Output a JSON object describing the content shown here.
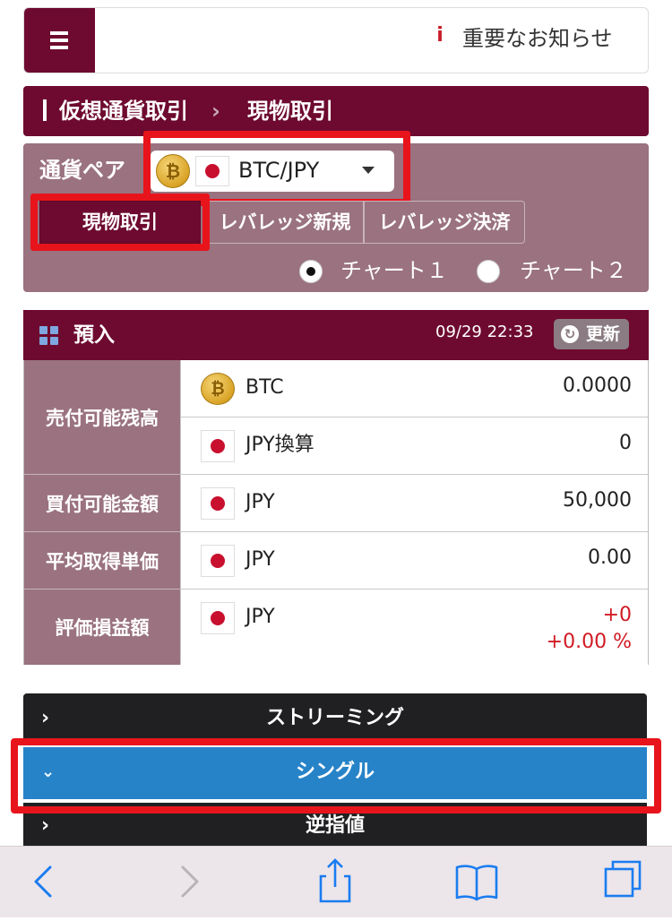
{
  "header": {
    "notice_icon": "i",
    "notice_label": "重要なお知らせ"
  },
  "breadcrumb": {
    "level1": "仮想通貨取引",
    "separator": "›",
    "level2": "現物取引"
  },
  "settings": {
    "pair_label": "通貨ペア",
    "pair_value": "BTC/JPY",
    "tabs": [
      "現物取引",
      "レバレッジ新規",
      "レバレッジ決済"
    ],
    "active_tab": "現物取引",
    "chart_options": [
      "チャート１",
      "チャート２"
    ],
    "chart_selected": "チャート１"
  },
  "account": {
    "title": "預入",
    "timestamp": "09/29 22:33",
    "refresh_label": "更新",
    "sell_available_label": "売付可能残高",
    "btc_currency": "BTC",
    "btc_value": "0.0000",
    "jpy_equiv_currency": "JPY換算",
    "jpy_equiv_value": "0",
    "buy_available_label": "買付可能金額",
    "buy_currency": "JPY",
    "buy_value": "50,000",
    "avg_price_label": "平均取得単価",
    "avg_currency": "JPY",
    "avg_value": "0.00",
    "pnl_label": "評価損益額",
    "pnl_currency": "JPY",
    "pnl_value": "+0",
    "pnl_percent": "+0.00 %"
  },
  "order_sections": {
    "streaming": "ストリーミング",
    "single": "シングル",
    "stop": "逆指値"
  },
  "colors": {
    "brand": "#6e0a2f",
    "panel": "#9a7280",
    "active_section": "#2783c8",
    "highlight": "#e8141c",
    "negative_red": "#d11a24"
  },
  "icons": {
    "menu": "hamburger-icon",
    "notice": "info-icon",
    "coin": "bitcoin-icon",
    "flag": "japan-flag-icon",
    "refresh": "refresh-icon",
    "grid": "grid-icon",
    "toolbar": [
      "back-icon",
      "forward-icon",
      "share-icon",
      "bookmarks-icon",
      "tabs-icon"
    ]
  }
}
